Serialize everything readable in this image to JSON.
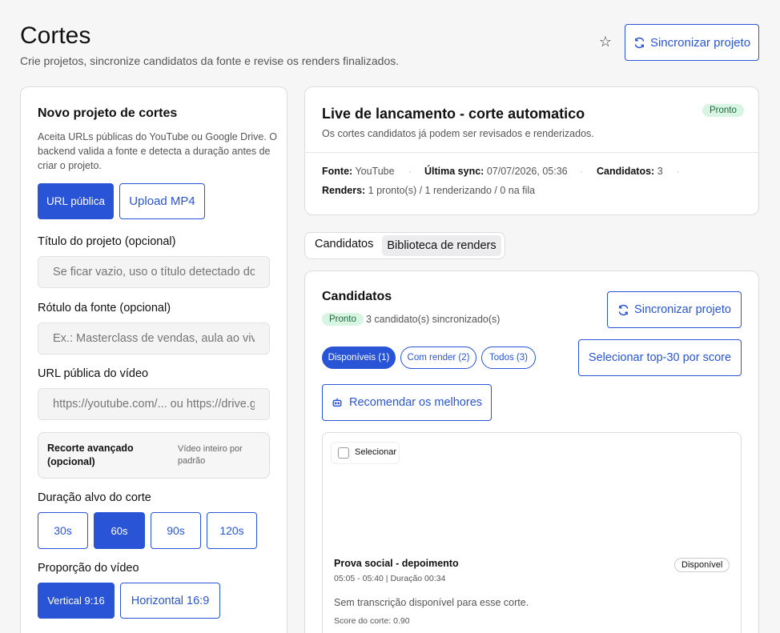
{
  "header": {
    "title": "Cortes",
    "subtitle": "Crie projetos, sincronize candidatos da fonte e revise os renders finalizados.",
    "sync_label": "Sincronizar projeto"
  },
  "new_project": {
    "title": "Novo projeto de cortes",
    "description": "Aceita URLs públicas do YouTube ou Google Drive. O backend valida a fonte e detecta a duração antes de criar o projeto.",
    "source_tabs": [
      "URL pública",
      "Upload MP4"
    ],
    "project_title_label": "Título do projeto (opcional)",
    "project_title_placeholder": "Se ficar vazio, uso o título detectado do vídeo",
    "source_label_label": "Rótulo da fonte (opcional)",
    "source_label_placeholder": "Ex.: Masterclass de vendas, aula ao vivo",
    "video_url_label": "URL pública do vídeo",
    "video_url_placeholder": "https://youtube.com/... ou https://drive.google.com/...",
    "advanced_title": "Recorte avançado (opcional)",
    "advanced_note": "Vídeo inteiro por padrão",
    "duration_label": "Duração alvo do corte",
    "durations": [
      "30s",
      "60s",
      "90s",
      "120s"
    ],
    "duration_selected": "60s",
    "ratio_label": "Proporção do vídeo",
    "ratios": [
      "Vertical 9:16",
      "Horizontal 16:9"
    ]
  },
  "project": {
    "title": "Live de lancamento - corte automatico",
    "status": "Pronto",
    "subtitle": "Os cortes candidatos já podem ser revisados e renderizados.",
    "source_key": "Fonte:",
    "source_val": "YouTube",
    "sync_key": "Última sync:",
    "sync_val": "07/07/2026, 05:36",
    "cand_key": "Candidatos:",
    "cand_val": "3",
    "renders_key": "Renders:",
    "renders_val": "1 pronto(s) / 1 renderizando / 0 na fila"
  },
  "tabs": [
    "Candidatos",
    "Biblioteca de renders"
  ],
  "candidates": {
    "title": "Candidatos",
    "status": "Pronto",
    "count_text": "3 candidato(s) sincronizado(s)",
    "sync_label": "Sincronizar projeto",
    "filters": [
      "Disponíveis (1)",
      "Com render (2)",
      "Todos (3)"
    ],
    "top30_label": "Selecionar top-30 por score",
    "recommend_label": "Recomendar os melhores",
    "clip": {
      "select_label": "Selecionar",
      "title": "Prova social - depoimento",
      "time": "05:05 - 05:40 | Duração 00:34",
      "status": "Disponível",
      "description": "Sem transcrição disponível para esse corte.",
      "score": "Score do corte: 0.90"
    }
  },
  "colors": {
    "accent": "#2a54d6",
    "badge_bg": "#d8f4e2",
    "badge_text": "#1f6a3d"
  },
  "icons": [
    "star-icon",
    "refresh-icon",
    "robot-icon"
  ]
}
